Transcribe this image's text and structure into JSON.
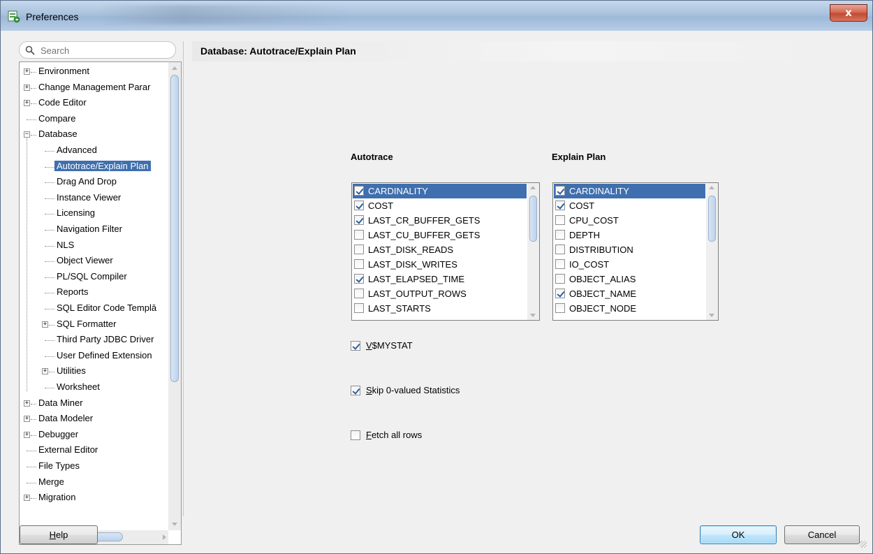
{
  "window": {
    "title": "Preferences",
    "close_label": "x"
  },
  "search": {
    "placeholder": "Search"
  },
  "tree": {
    "items": [
      {
        "label": "Environment",
        "expander": "+"
      },
      {
        "label": "Change Management Parar",
        "expander": "+"
      },
      {
        "label": "Code Editor",
        "expander": "+"
      },
      {
        "label": "Compare",
        "expander": ""
      },
      {
        "label": "Database",
        "expander": "-"
      },
      {
        "label": "Advanced",
        "expander": ""
      },
      {
        "label": "Autotrace/Explain Plan",
        "expander": "",
        "selected": true
      },
      {
        "label": "Drag And Drop",
        "expander": ""
      },
      {
        "label": "Instance Viewer",
        "expander": ""
      },
      {
        "label": "Licensing",
        "expander": ""
      },
      {
        "label": "Navigation Filter",
        "expander": ""
      },
      {
        "label": "NLS",
        "expander": ""
      },
      {
        "label": "Object Viewer",
        "expander": ""
      },
      {
        "label": "PL/SQL Compiler",
        "expander": ""
      },
      {
        "label": "Reports",
        "expander": ""
      },
      {
        "label": "SQL Editor Code Templā",
        "expander": ""
      },
      {
        "label": "SQL Formatter",
        "expander": "+"
      },
      {
        "label": "Third Party JDBC Driver",
        "expander": ""
      },
      {
        "label": "User Defined Extension",
        "expander": ""
      },
      {
        "label": "Utilities",
        "expander": "+"
      },
      {
        "label": "Worksheet",
        "expander": ""
      },
      {
        "label": "Data Miner",
        "expander": "+"
      },
      {
        "label": "Data Modeler",
        "expander": "+"
      },
      {
        "label": "Debugger",
        "expander": "+"
      },
      {
        "label": "External Editor",
        "expander": ""
      },
      {
        "label": "File Types",
        "expander": ""
      },
      {
        "label": "Merge",
        "expander": ""
      },
      {
        "label": "Migration",
        "expander": "+"
      }
    ]
  },
  "page": {
    "title": "Database: Autotrace/Explain Plan"
  },
  "autotrace": {
    "heading": "Autotrace",
    "items": [
      {
        "label": "CARDINALITY",
        "checked": true,
        "selected": true
      },
      {
        "label": "COST",
        "checked": true
      },
      {
        "label": "LAST_CR_BUFFER_GETS",
        "checked": true
      },
      {
        "label": "LAST_CU_BUFFER_GETS",
        "checked": false
      },
      {
        "label": "LAST_DISK_READS",
        "checked": false
      },
      {
        "label": "LAST_DISK_WRITES",
        "checked": false
      },
      {
        "label": "LAST_ELAPSED_TIME",
        "checked": true
      },
      {
        "label": "LAST_OUTPUT_ROWS",
        "checked": false
      },
      {
        "label": "LAST_STARTS",
        "checked": false
      }
    ]
  },
  "explain_plan": {
    "heading": "Explain Plan",
    "items": [
      {
        "label": "CARDINALITY",
        "checked": true,
        "selected": true
      },
      {
        "label": "COST",
        "checked": true
      },
      {
        "label": "CPU_COST",
        "checked": false
      },
      {
        "label": "DEPTH",
        "checked": false
      },
      {
        "label": "DISTRIBUTION",
        "checked": false
      },
      {
        "label": "IO_COST",
        "checked": false
      },
      {
        "label": "OBJECT_ALIAS",
        "checked": false
      },
      {
        "label": "OBJECT_NAME",
        "checked": true
      },
      {
        "label": "OBJECT_NODE",
        "checked": false
      }
    ]
  },
  "options": {
    "vmystat": {
      "mnemonic": "V",
      "rest": "$MYSTAT",
      "checked": true
    },
    "skip_zero": {
      "mnemonic": "S",
      "rest": "kip 0-valued Statistics",
      "checked": true
    },
    "fetch_all": {
      "mnemonic": "F",
      "rest": "etch all rows",
      "checked": false
    }
  },
  "buttons": {
    "help": {
      "mnemonic": "H",
      "rest": "elp"
    },
    "ok": "OK",
    "cancel": "Cancel"
  }
}
